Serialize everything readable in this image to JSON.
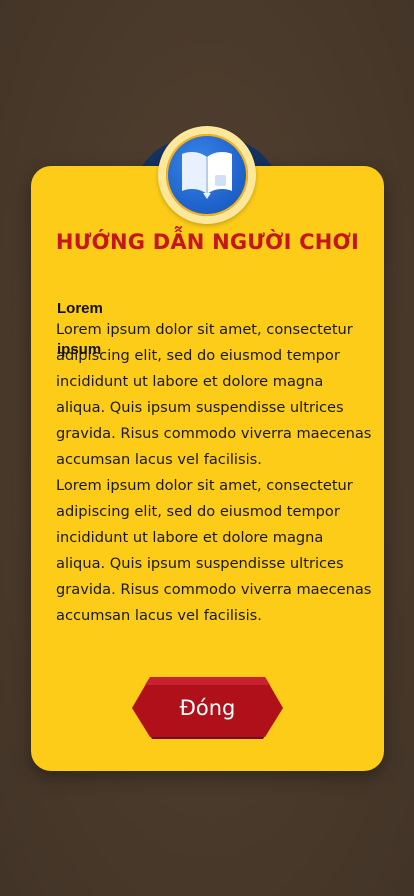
{
  "dialog": {
    "title": "HƯỚNG DẪN NGƯỜI CHƠI",
    "icon": "book-icon",
    "heading": "Lorem ipsum",
    "paragraphs": [
      "Lorem ipsum dolor sit amet, consectetur adipiscing elit, sed do eiusmod tempor incididunt ut labore et dolore magna aliqua. Quis ipsum suspendisse ultrices gravida. Risus commodo viverra maecenas accumsan lacus vel facilisis.",
      "Lorem ipsum dolor sit amet, consectetur adipiscing elit, sed do eiusmod tempor incididunt ut labore et dolore magna aliqua. Quis ipsum suspendisse ultrices gravida. Risus commodo viverra maecenas accumsan lacus vel facilisis."
    ],
    "close_label": "Đóng"
  },
  "colors": {
    "modal_bg": "#fccc18",
    "title": "#c4161c",
    "button": "#b0101a",
    "backdrop": "#4a3a2c"
  }
}
